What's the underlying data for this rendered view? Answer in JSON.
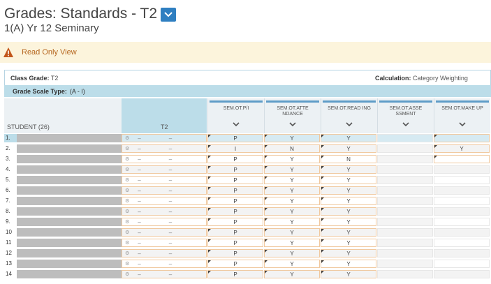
{
  "header": {
    "title": "Grades: Standards - T2",
    "subtitle": "1(A) Yr 12 Seminary"
  },
  "banner": {
    "text": "Read Only View",
    "color": "#b5651d"
  },
  "info": {
    "class_grade_label": "Class Grade:",
    "class_grade_value": "T2",
    "calculation_label": "Calculation:",
    "calculation_value": "Category Weighting",
    "scale_label": "Grade Scale Type:",
    "scale_value": "(A - I)"
  },
  "columns": {
    "student": "STUDENT (26)",
    "t2": "T2",
    "standards": [
      {
        "name": "SEM.OT.P/I",
        "key": "pi"
      },
      {
        "name": "SEM.OT.ATTE NDANCE",
        "key": "att"
      },
      {
        "name": "SEM.OT.READ ING",
        "key": "read"
      },
      {
        "name": "SEM.OT.ASSE SSMENT",
        "key": "assess"
      },
      {
        "name": "SEM.OT.MAKE UP",
        "key": "makeup"
      }
    ]
  },
  "rows": [
    {
      "num": "1.",
      "t2": [
        "–",
        "–"
      ],
      "pi": "P",
      "att": "Y",
      "read": "Y",
      "assess": "",
      "makeup": ""
    },
    {
      "num": "2.",
      "t2": [
        "–",
        "–"
      ],
      "pi": "I",
      "att": "N",
      "read": "Y",
      "assess": "",
      "makeup": "Y"
    },
    {
      "num": "3.",
      "t2": [
        "–",
        "–"
      ],
      "pi": "P",
      "att": "Y",
      "read": "N",
      "assess": "",
      "makeup": ""
    },
    {
      "num": "4.",
      "t2": [
        "–",
        "–"
      ],
      "pi": "P",
      "att": "Y",
      "read": "Y",
      "assess": "",
      "makeup": ""
    },
    {
      "num": "5.",
      "t2": [
        "–",
        "–"
      ],
      "pi": "P",
      "att": "Y",
      "read": "Y",
      "assess": "",
      "makeup": ""
    },
    {
      "num": "6.",
      "t2": [
        "–",
        "–"
      ],
      "pi": "P",
      "att": "Y",
      "read": "Y",
      "assess": "",
      "makeup": ""
    },
    {
      "num": "7.",
      "t2": [
        "–",
        "–"
      ],
      "pi": "P",
      "att": "Y",
      "read": "Y",
      "assess": "",
      "makeup": ""
    },
    {
      "num": "8.",
      "t2": [
        "–",
        "–"
      ],
      "pi": "P",
      "att": "Y",
      "read": "Y",
      "assess": "",
      "makeup": ""
    },
    {
      "num": "9.",
      "t2": [
        "–",
        "–"
      ],
      "pi": "P",
      "att": "Y",
      "read": "Y",
      "assess": "",
      "makeup": ""
    },
    {
      "num": "10",
      "t2": [
        "–",
        "–"
      ],
      "pi": "P",
      "att": "Y",
      "read": "Y",
      "assess": "",
      "makeup": ""
    },
    {
      "num": "11",
      "t2": [
        "–",
        "–"
      ],
      "pi": "P",
      "att": "Y",
      "read": "Y",
      "assess": "",
      "makeup": ""
    },
    {
      "num": "12",
      "t2": [
        "–",
        "–"
      ],
      "pi": "P",
      "att": "Y",
      "read": "Y",
      "assess": "",
      "makeup": ""
    },
    {
      "num": "13",
      "t2": [
        "–",
        "–"
      ],
      "pi": "P",
      "att": "Y",
      "read": "Y",
      "assess": "",
      "makeup": ""
    },
    {
      "num": "14",
      "t2": [
        "–",
        "–"
      ],
      "pi": "P",
      "att": "Y",
      "read": "Y",
      "assess": "",
      "makeup": ""
    }
  ],
  "colors": {
    "accent": "#2f7fc1",
    "header_band": "#bcdde9",
    "cell_border": "#f0c9a0"
  }
}
